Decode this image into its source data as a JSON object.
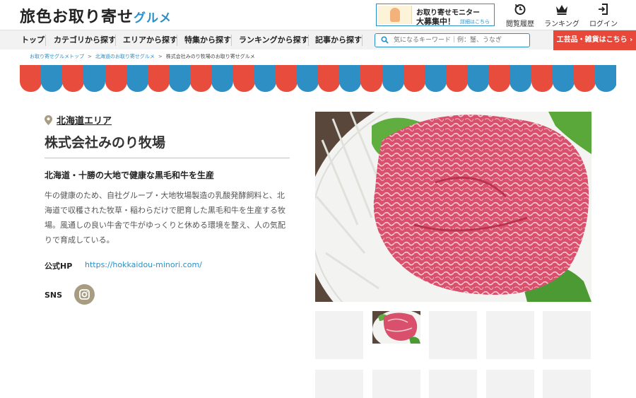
{
  "header": {
    "logo_main": "旅色お取り寄せ",
    "logo_accent": "グルメ",
    "monitor": {
      "line1": "お取り寄せモニター",
      "line2": "大募集中！",
      "link": "詳細はこちら"
    },
    "history_label": "閲覧履歴",
    "ranking_label": "ランキング",
    "login_label": "ログイン"
  },
  "nav": {
    "items": [
      "トップ",
      "カテゴリから探す",
      "エリアから探す",
      "特集から探す",
      "ランキングから探す",
      "記事から探す"
    ],
    "search_placeholder": "気になるキーワード｜例：蟹、うなぎ",
    "kougei_label": "工芸品・雑貨はこちら ›"
  },
  "breadcrumb": [
    "お取り寄せグルメトップ",
    "北海道のお取り寄せグルメ",
    "株式会社みのり牧場のお取り寄せグルメ"
  ],
  "shop": {
    "area": "北海道エリア",
    "name": "株式会社みのり牧場",
    "catch": "北海道・十勝の大地で健康な黒毛和牛を生産",
    "description": "牛の健康のため、自社グループ・大地牧場製造の乳酸発酵飼料と、北海道で収穫された牧草・稲わらだけで肥育した黒毛和牛を生産する牧場。風通しの良い牛舎で牛がゆっくりと休める環境を整え、人の気配りで育成している。",
    "hp_label": "公式HP",
    "hp_url": "https://hokkaidou-minori.com/",
    "sns_label": "SNS"
  },
  "colors": {
    "brand_blue": "#2a8fc6",
    "accent_red": "#e8483a",
    "awning_red": "#e84c3d",
    "awning_blue": "#2e8fc4"
  },
  "icons": [
    "history-icon",
    "crown-icon",
    "login-icon",
    "search-icon",
    "pin-icon",
    "instagram-icon"
  ]
}
